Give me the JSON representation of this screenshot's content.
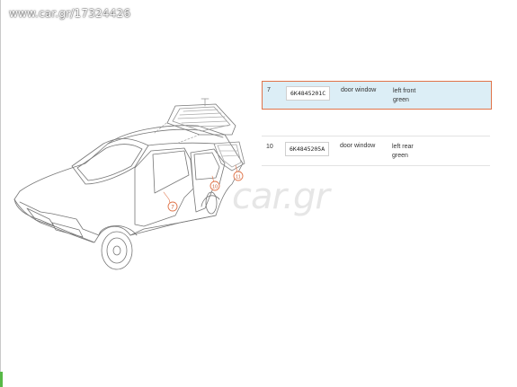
{
  "watermark": {
    "top_text": "www.car.gr/17324426",
    "logo_text": "car.gr"
  },
  "diagram": {
    "callouts": [
      "7",
      "10",
      "11"
    ]
  },
  "parts_table": {
    "rows": [
      {
        "number": "7",
        "part_no": "6K4845201C",
        "description": "door window",
        "note_line1": "left front",
        "note_line2": "green",
        "selected": true
      },
      {
        "number": "10",
        "part_no": "6K4845205A",
        "description": "door window",
        "note_line1": "left rear",
        "note_line2": "green",
        "selected": false
      }
    ]
  },
  "colors": {
    "selected_row_background": "#dceef6",
    "selected_row_border": "#e0744a",
    "callout_circle": "#e0744a",
    "accent_green": "#57b947"
  }
}
